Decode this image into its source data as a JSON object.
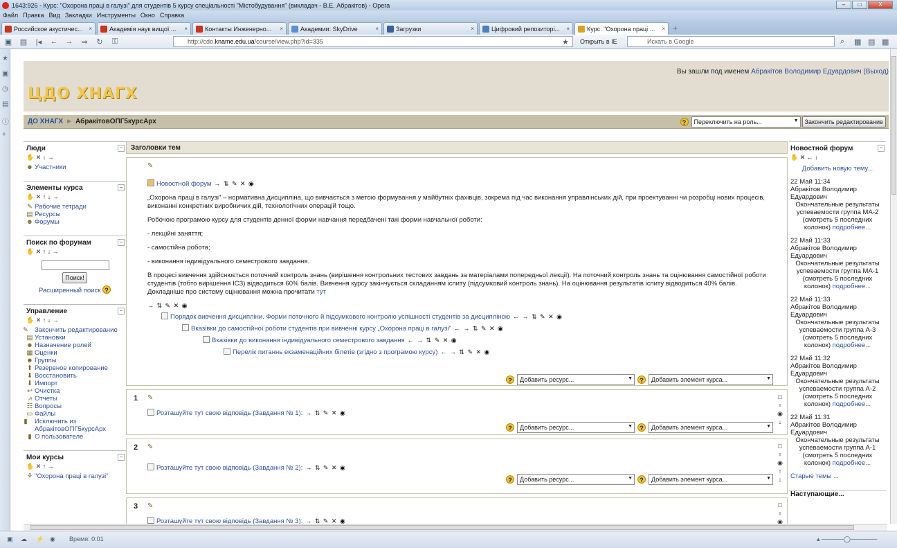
{
  "window": {
    "title": "1643:926 - Курс: \"Охорона праці в галузі\" для студентів 5 курсу спеціальності \"Містобудування\" (викладач - В.Е. Абракітов) - Opera",
    "min_label": "–",
    "max_label": "□",
    "close_label": "X"
  },
  "menu": [
    "Файл",
    "Правка",
    "Вид",
    "Закладки",
    "Инструменты",
    "Окно",
    "Справка"
  ],
  "tabs": [
    {
      "label": "Российское акустичес...",
      "color": "#c8341e"
    },
    {
      "label": "Академія наук вищої ...",
      "color": "#c8341e"
    },
    {
      "label": "Контакты Инженерно...",
      "color": "#c8341e"
    },
    {
      "label": "Академии: SkyDrive",
      "color": "#5b8fcf"
    },
    {
      "label": "Загрузки",
      "color": "#3a5f9a"
    },
    {
      "label": "Цифровий репозиторі...",
      "color": "#4a7fc0"
    },
    {
      "label": "Курс: \"Охорона праці ...",
      "color": "#d9a326"
    }
  ],
  "tab_close": "×",
  "newtab": "+",
  "address": {
    "prefix": "http://cdo.",
    "host": "kname.edu.ua",
    "path": "/course/view.php?id=335",
    "open_ie": "Открыть в IE",
    "search_placeholder": "Искать в Google"
  },
  "status": {
    "time": "Время:  0:01"
  },
  "header": {
    "logo": "ЦДО ХНАГХ",
    "logged_in_prefix": "Вы зашли под именем ",
    "user": "Абракітов Володимир Едуардович",
    "logout": "(Выход)"
  },
  "navbar": {
    "home": "ДО ХНАГХ",
    "separator": "►",
    "course": "АбракітовОПГ5курсАрх",
    "role_select": "Переключить на роль...",
    "stop_editing": "Закончить редактирование"
  },
  "left_blocks": [
    {
      "title": "Люди",
      "controls": "✋ ✕ ↓ →",
      "items": [
        {
          "icon": "people-icon",
          "label": "Участники"
        }
      ]
    },
    {
      "title": "Элементы курса",
      "controls": "✋ ✕ ↑ ↓ →",
      "items": [
        {
          "icon": "notebook-icon",
          "label": "Рабочие тетради"
        },
        {
          "icon": "resource-icon",
          "label": "Ресурсы"
        },
        {
          "icon": "forum-icon",
          "label": "Форумы"
        }
      ]
    },
    {
      "title": "Поиск по форумам",
      "controls": "✋ ✕ ↑ ↓ →",
      "search_button": "Поиск!",
      "advanced": "Расширенный поиск"
    },
    {
      "title": "Управление",
      "controls": "✋ ✕ ↑ ↓ →",
      "items": [
        {
          "icon": "pen-icon",
          "label": "Закончить редактирование"
        },
        {
          "icon": "settings-icon",
          "label": "Установки"
        },
        {
          "icon": "roles-icon",
          "label": "Назначение ролей"
        },
        {
          "icon": "grades-icon",
          "label": "Оценки"
        },
        {
          "icon": "groups-icon",
          "label": "Группы"
        },
        {
          "icon": "backup-icon",
          "label": "Резервное копирование"
        },
        {
          "icon": "restore-icon",
          "label": "Восстановить"
        },
        {
          "icon": "import-icon",
          "label": "Импорт"
        },
        {
          "icon": "reset-icon",
          "label": "Очистка"
        },
        {
          "icon": "reports-icon",
          "label": "Отчеты"
        },
        {
          "icon": "questions-icon",
          "label": "Вопросы"
        },
        {
          "icon": "files-icon",
          "label": "Файлы"
        },
        {
          "icon": "unenrol-icon",
          "label": "Исключить из АбракітовОПГ5курсАрх"
        },
        {
          "icon": "profile-icon",
          "label": "О пользователе"
        }
      ]
    },
    {
      "title": "Мои курсы",
      "controls": "✋ ✕ ↑ →",
      "items": [
        {
          "icon": "course-icon",
          "label": "\"Охорона праці в галузі\""
        }
      ]
    }
  ],
  "center": {
    "topics_header": "Заголовки тем",
    "news_forum": "Новостной форум",
    "paragraphs": [
      "„Охорона праці в галузі\" – нормативна дисципліна, що вивчається з метою формування у майбутніх фахівців, зокрема під час виконання управлінських дій, при проектуванні чи розробці нових процесів, виконанні конкретних виробничих дій, технологічних операцій тощо.",
      "Робочою програмою курсу для студентів денної форми навчання передбачені такі форми навчальної роботи:",
      "- лекційні заняття;",
      "- самостійна робота;",
      "- виконання індивідуального семестрового завдання."
    ],
    "grading_text": "В процесі вивчення здійснюється поточний контроль знань (вирішення контрольних тестових завдань за матеріалами попередньої лекції). На поточний контроль знань та оцінювання самостійної роботи студентів (тобто вирішення ІСЗ) відводиться 60% балів. Вивчення курсу закінчується складанням іспиту (підсумковий контроль знань). На оцінювання результатів іспиту відводиться 40% балів. Докладніше про систему оцінювання можна прочитати ",
    "grading_link": "тут",
    "resources": [
      "Порядок вивчення дисципліни. Форми поточного й підсумкового контролю успішності студентів за дисципліною",
      "Вказівки до самостійної роботи студентів при вивченні курсу „Охорона праці в галузі\"",
      "Вказівки до виконання індивідуального семестрового завдання",
      "Перелік питаннь екзаменаційних білетів (згідно з програмою курсу)"
    ],
    "add_resource": "Добавить ресурс...",
    "add_activity": "Добавить элемент курса...",
    "sections": [
      {
        "num": "1",
        "assignment": "Розташуйте тут свою відповідь (Завдання № 1):"
      },
      {
        "num": "2",
        "assignment": "Розташуйте тут свою відповідь (Завдання № 2):"
      },
      {
        "num": "3",
        "assignment": "Розташуйте тут свою відповідь (Завдання № 3):"
      }
    ]
  },
  "right": {
    "title": "Новостной форум",
    "controls": "✋ ✕ ← ↓",
    "add_topic": "Добавить новую тему...",
    "posts": [
      {
        "date": "22 Май 11:34",
        "author": "Абракітов Володимир Едуардович",
        "text": "Окончательные результаты успеваемости группа МА-2 (смотреть 5 последних колонок)"
      },
      {
        "date": "22 Май 11:33",
        "author": "Абракітов Володимир Едуардович",
        "text": "Окончательные результаты успеваемости группа МА-1 (смотреть 5 последних колонок)"
      },
      {
        "date": "22 Май 11:33",
        "author": "Абракітов Володимир Едуардович",
        "text": "Окончательные результаты успеваемости группа А-3 (смотреть 5 последних колонок)"
      },
      {
        "date": "22 Май 11:32",
        "author": "Абракітов Володимир Едуардович",
        "text": "Окончательные результаты успеваемости группа А-2 (смотреть 5 последних колонок)"
      },
      {
        "date": "22 Май 11:31",
        "author": "Абракітов Володимир Едуардович",
        "text": "Окончательные результаты успеваемости группа А-1 (смотреть 5 последних колонок)"
      }
    ],
    "more": "подробнее...",
    "old_topics": "Старые темы ...",
    "next_block": "Наступающие..."
  },
  "icons": {
    "help": "?",
    "toggle": "−",
    "pen": "✎",
    "edit_controls": "→ ⇅ ✎ ✕ ◉",
    "edit_controls_short": "→ ⇅ ✎ ✕ ◉",
    "resource_controls": "← → ⇅ ✎ ✕ ◉",
    "dropdown": "▼"
  }
}
